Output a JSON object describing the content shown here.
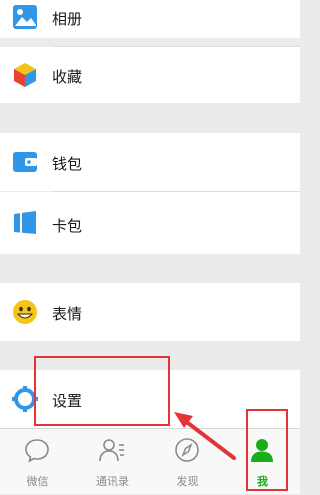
{
  "menu": {
    "album": "相册",
    "favorites": "收藏",
    "wallet": "钱包",
    "cards": "卡包",
    "stickers": "表情",
    "settings": "设置"
  },
  "tabbar": {
    "chats": "微信",
    "contacts": "通讯录",
    "discover": "发现",
    "me": "我"
  },
  "colors": {
    "accent_green": "#1aad19",
    "icon_blue": "#2f96e8",
    "annotation_red": "#e5333a",
    "sticker_yellow": "#f6c519"
  },
  "icons": [
    "album-icon",
    "favorites-icon",
    "wallet-icon",
    "cards-icon",
    "stickers-icon",
    "settings-icon",
    "chats-icon",
    "contacts-icon",
    "discover-icon",
    "me-icon"
  ]
}
